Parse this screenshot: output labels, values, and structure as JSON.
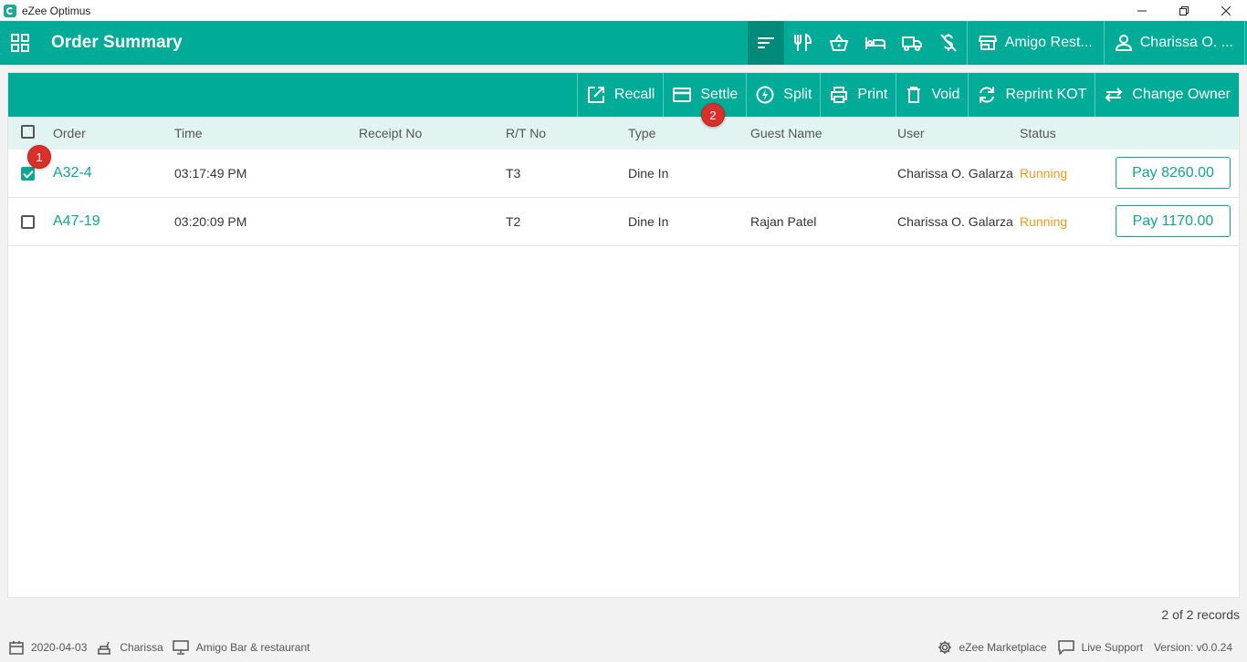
{
  "window": {
    "title": "eZee Optimus",
    "minimize": "—",
    "restore": "❐",
    "close": "✕"
  },
  "appbar": {
    "title": "Order Summary",
    "property": "Amigo Rest...",
    "user": "Charissa O. ..."
  },
  "toolbar": {
    "recall": "Recall",
    "settle": "Settle",
    "split": "Split",
    "print": "Print",
    "void": "Void",
    "reprint_kot": "Reprint KOT",
    "change_owner": "Change Owner"
  },
  "table": {
    "headers": {
      "order": "Order",
      "time": "Time",
      "receipt_no": "Receipt No",
      "rt_no": "R/T No",
      "type": "Type",
      "guest_name": "Guest Name",
      "user": "User",
      "status": "Status"
    },
    "rows": [
      {
        "checked": true,
        "order": "A32-4",
        "time": "03:17:49 PM",
        "receipt_no": "",
        "rt_no": "T3",
        "type": "Dine In",
        "guest_name": "",
        "user": "Charissa O. Galarza",
        "status": "Running",
        "pay": "Pay 8260.00"
      },
      {
        "checked": false,
        "order": "A47-19",
        "time": "03:20:09 PM",
        "receipt_no": "",
        "rt_no": "T2",
        "type": "Dine In",
        "guest_name": "Rajan Patel",
        "user": "Charissa O. Galarza",
        "status": "Running",
        "pay": "Pay 1170.00"
      }
    ]
  },
  "markers": {
    "m1": "1",
    "m2": "2"
  },
  "records": "2 of 2 records",
  "statusbar": {
    "date": "2020-04-03",
    "user": "Charissa",
    "outlet": "Amigo Bar & restaurant",
    "marketplace": "eZee Marketplace",
    "support": "Live Support",
    "version": "Version: v0.0.24"
  },
  "colors": {
    "primary": "#00ac97",
    "header_bg": "#e1f4f1",
    "link": "#10a592",
    "status_running": "#f39a1d",
    "marker": "#d9302b"
  }
}
